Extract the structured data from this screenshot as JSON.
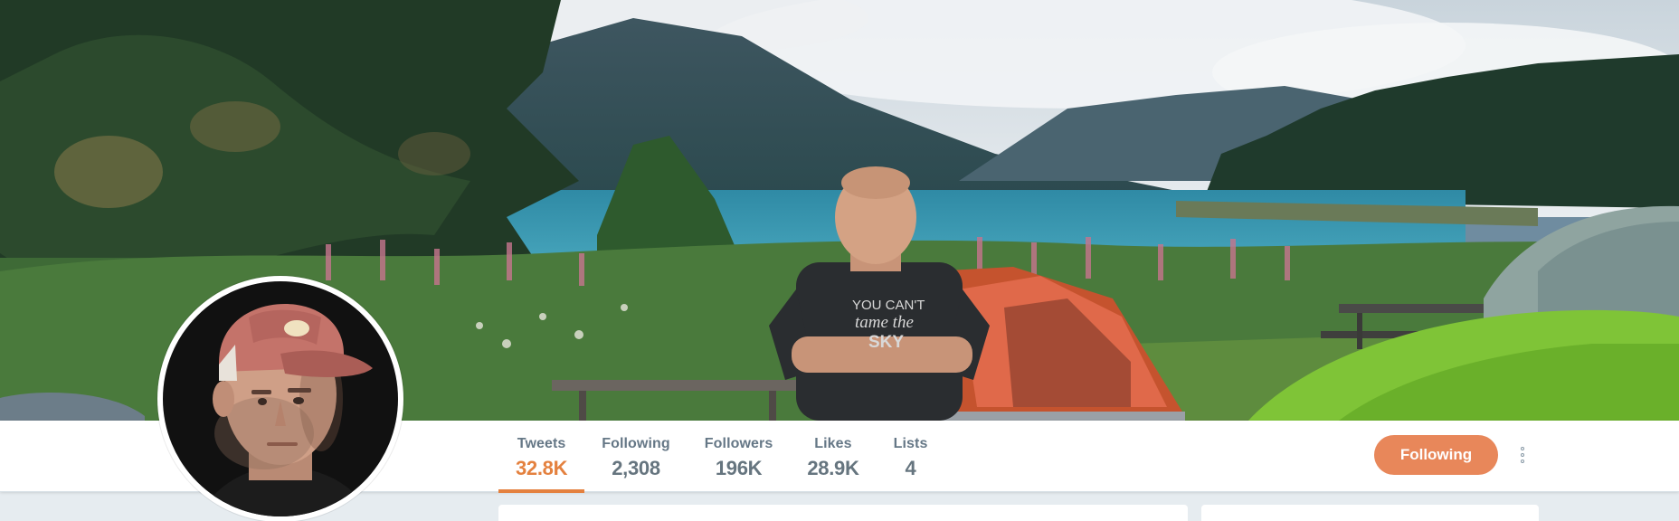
{
  "profile": {
    "stats": [
      {
        "label": "Tweets",
        "value": "32.8K",
        "active": true
      },
      {
        "label": "Following",
        "value": "2,308",
        "active": false
      },
      {
        "label": "Followers",
        "value": "196K",
        "active": false
      },
      {
        "label": "Likes",
        "value": "28.9K",
        "active": false
      },
      {
        "label": "Lists",
        "value": "4",
        "active": false
      }
    ],
    "follow_button_label": "Following"
  },
  "header_photo": {
    "shirt_text_line1": "YOU CAN'T",
    "shirt_text_line2": "tame the",
    "shirt_text_line3": "SKY"
  },
  "colors": {
    "accent": "#e4813f",
    "follow_button": "#e8875a",
    "stat_label": "#657786",
    "page_background": "#e6ecf0"
  },
  "icons": {
    "more": "vertical-ellipsis-icon"
  }
}
